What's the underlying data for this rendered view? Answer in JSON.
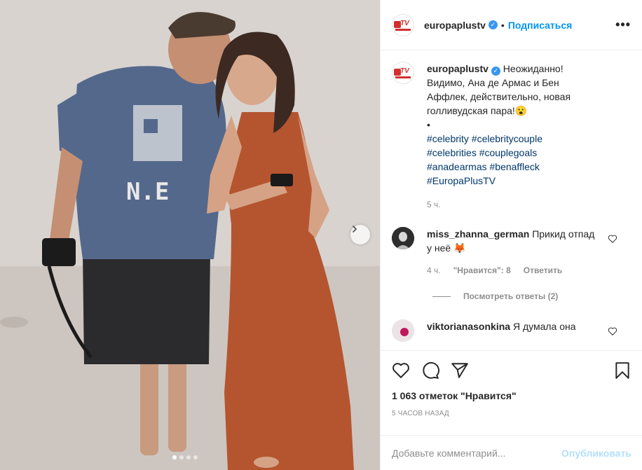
{
  "header": {
    "username": "europaplustv",
    "separator": "•",
    "follow_label": "Подписаться",
    "more_label": "•••"
  },
  "caption": {
    "username": "europaplustv",
    "text": "Неожиданно! Видимо, Ана де Армас и Бен Аффлек, действительно, новая голливудская пара!😮",
    "bullet": "•",
    "hashtags": [
      "#celebrity #celebritycouple",
      "#celebrities #couplegoals",
      "#anadearmas #benaffleck",
      "#EuropaPlusTV"
    ],
    "time": "5 ч."
  },
  "comments": [
    {
      "username": "miss_zhanna_german",
      "text": "Прикид отпад у неё 🦊",
      "time": "4 ч.",
      "likes": "\"Нравится\": 8",
      "reply_label": "Ответить",
      "view_replies": "Посмотреть ответы (2)"
    },
    {
      "username": "viktorianasonkina",
      "text": "Я думала она"
    }
  ],
  "post": {
    "likes_text": "1 063 отметок \"Нравится\"",
    "timestamp": "5 ЧАСОВ НАЗАД"
  },
  "composer": {
    "placeholder": "Добавьте комментарий...",
    "post_label": "Опубликовать"
  },
  "carousel": {
    "slides": 4,
    "active_index": 0
  },
  "colors": {
    "accent": "#0095f6",
    "verified": "#3897f0",
    "hashtag": "#00376b",
    "muted": "#8e8e8e"
  }
}
